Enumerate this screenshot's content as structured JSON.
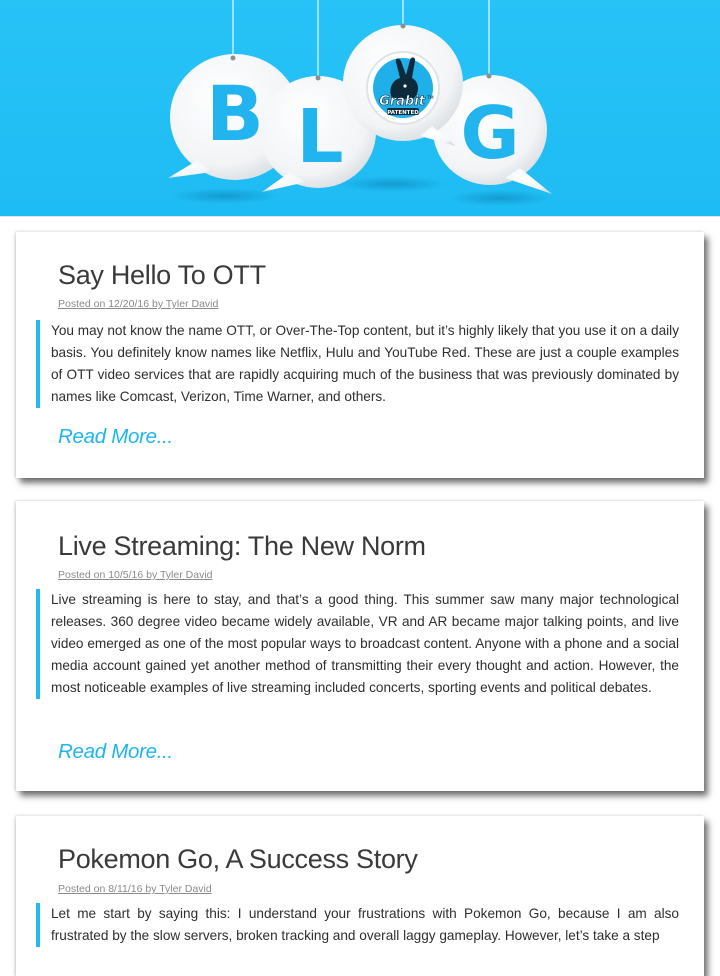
{
  "banner": {
    "letters": [
      "B",
      "L",
      "O",
      "G"
    ],
    "logo_text": "Grabit",
    "logo_sub": "PATENTED",
    "logo_tm": "TM",
    "bg_color": "#27c3f7",
    "letter_color": "#22b4ee"
  },
  "posts": [
    {
      "title": "Say Hello To OTT",
      "meta": "Posted on 12/20/16 by Tyler David",
      "excerpt": "You may not know the name OTT, or Over-The-Top content, but it’s highly likely that you use it on a daily basis. You definitely know names like Netflix, Hulu and YouTube Red. These are just a couple examples of OTT video services that are rapidly acquiring much of the business that was previously dominated by names like Comcast, Verizon, Time Warner, and others.",
      "read_more": "Read More..."
    },
    {
      "title": "Live Streaming: The New Norm",
      "meta": "Posted on 10/5/16 by Tyler David",
      "excerpt": "Live streaming is here to stay, and that’s a good thing. This summer saw many major technological releases. 360 degree video became widely available, VR and AR became major talking points, and live video emerged as one of the most popular ways to broadcast content. Anyone with a phone and a social media account gained yet another method of transmitting their every thought and action. However, the most noticeable examples of live streaming included concerts, sporting events and political debates.",
      "read_more": "Read More..."
    },
    {
      "title": "Pokemon Go, A Success Story",
      "meta": "Posted on 8/11/16 by Tyler David",
      "excerpt": "Let me start by saying this: I understand your frustrations with Pokemon Go, because I am also frustrated by the slow servers, broken tracking and overall laggy gameplay. However, let’s take a step"
    }
  ],
  "colors": {
    "accent": "#1fb5ee",
    "title": "#3a3a3a",
    "meta": "#8a8a8a"
  }
}
